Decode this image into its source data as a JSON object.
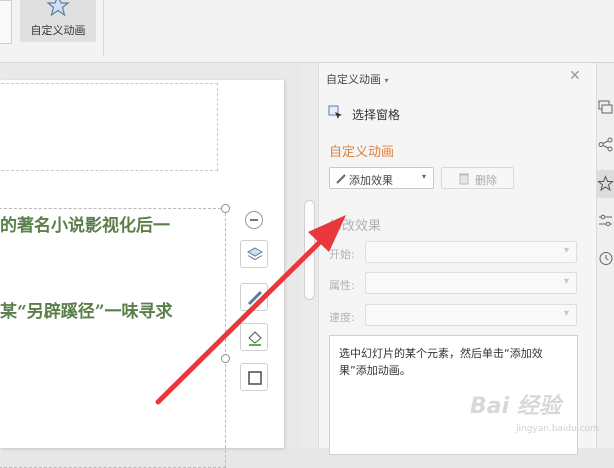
{
  "ribbon": {
    "custom_animation_label": "自定义动画"
  },
  "slide": {
    "line1": "的著名小说影视化后一",
    "line2": "某“另辟蹊径”一味寻求"
  },
  "pane": {
    "title": "自定义动画",
    "title_caret": "▾",
    "close": "✕",
    "select_pane_label": "选择窗格",
    "section_title": "自定义动画",
    "add_effect_label": "添加效果",
    "add_effect_caret": "▾",
    "delete_label": "删除",
    "modify_title": "修改效果",
    "start_label": "开始:",
    "property_label": "属性:",
    "speed_label": "速度:",
    "hint": "选中幻灯片的某个元素，然后单击“添加效果”添加动画。"
  },
  "watermark": {
    "main": "Bai 经验",
    "sub": "jingyan.baidu.com"
  },
  "colors": {
    "accent_orange": "#e0803c",
    "slide_text_green": "#5b7f4a",
    "arrow_red": "#e8383d"
  }
}
